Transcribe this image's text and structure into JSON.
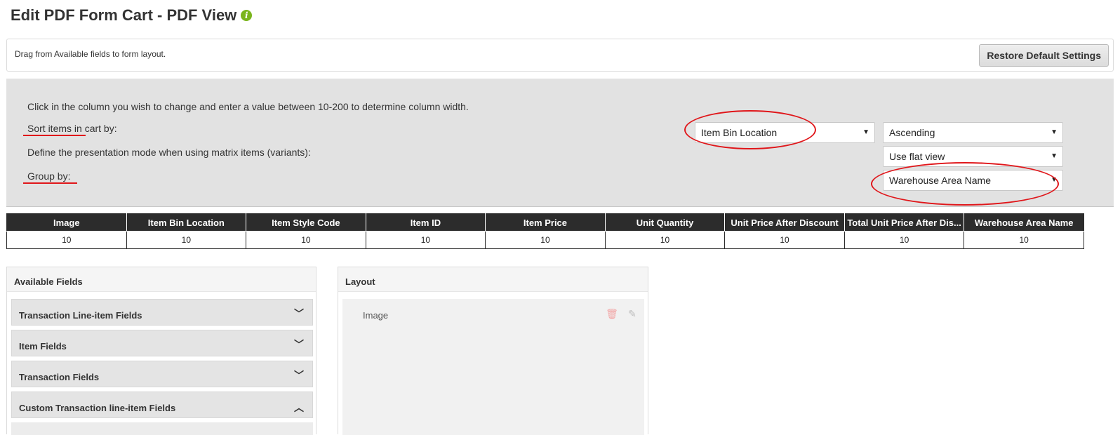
{
  "page": {
    "title": "Edit PDF Form Cart - PDF View",
    "info_icon": "info-icon",
    "accent_color": "#7ab51d",
    "annotation_color": "#e0161a"
  },
  "hint_bar": {
    "text": "Drag from Available fields to form layout.",
    "restore_label": "Restore Default Settings"
  },
  "settings": {
    "column_width_text": "Click in the column you wish to change and enter a value between 10-200 to determine column width.",
    "sort_label": "Sort items in cart by:",
    "presentation_label": "Define the presentation mode when using matrix items (variants):",
    "group_label": "Group by:",
    "sort_field_selected": "Item Bin Location",
    "sort_order_selected": "Ascending",
    "presentation_selected": "Use flat view",
    "group_selected": "Warehouse Area Name"
  },
  "columns": {
    "headers": [
      "Image",
      "Item Bin Location",
      "Item Style Code",
      "Item ID",
      "Item Price",
      "Unit Quantity",
      "Unit Price After Discount",
      "Total Unit Price After Dis...",
      "Warehouse Area Name"
    ],
    "widths": [
      "10",
      "10",
      "10",
      "10",
      "10",
      "10",
      "10",
      "10",
      "10"
    ]
  },
  "available_fields": {
    "title": "Available Fields",
    "groups": [
      {
        "label": "Transaction Line-item Fields",
        "state": "collapsed"
      },
      {
        "label": "Item Fields",
        "state": "collapsed"
      },
      {
        "label": "Transaction Fields",
        "state": "collapsed"
      },
      {
        "label": "Custom Transaction line-item Fields",
        "state": "expanded"
      }
    ]
  },
  "layout": {
    "title": "Layout",
    "items": [
      {
        "label": "Image",
        "delete_icon": "trash-icon",
        "edit_icon": "pencil-icon"
      }
    ]
  }
}
